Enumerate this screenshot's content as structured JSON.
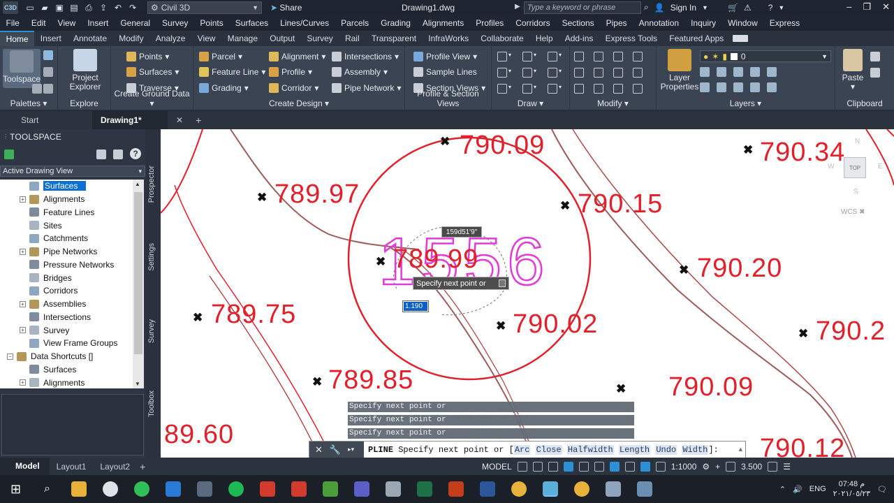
{
  "app": {
    "workspace": "Civil 3D",
    "share_label": "Share",
    "document_title": "Drawing1.dwg",
    "search_placeholder": "Type a keyword or phrase",
    "sign_in": "Sign In",
    "logo_text": "C3D"
  },
  "menu": [
    "File",
    "Edit",
    "View",
    "Insert",
    "General",
    "Survey",
    "Points",
    "Surfaces",
    "Lines/Curves",
    "Parcels",
    "Grading",
    "Alignments",
    "Profiles",
    "Corridors",
    "Sections",
    "Pipes",
    "Annotation",
    "Inquiry",
    "Window",
    "Express"
  ],
  "ribbon_tabs": [
    "Home",
    "Insert",
    "Annotate",
    "Modify",
    "Analyze",
    "View",
    "Manage",
    "Output",
    "Survey",
    "Rail",
    "Transparent",
    "InfraWorks",
    "Collaborate",
    "Help",
    "Add-ins",
    "Express Tools",
    "Featured Apps"
  ],
  "ribbon": {
    "palettes": {
      "toolspace": "Toolspace",
      "label": "Palettes"
    },
    "explore": {
      "project_explorer_1": "Project",
      "project_explorer_2": "Explorer",
      "label": "Explore"
    },
    "ground": {
      "points": "Points",
      "surfaces": "Surfaces",
      "traverse": "Traverse",
      "label": "Create Ground Data"
    },
    "design": {
      "parcel": "Parcel",
      "feature_line": "Feature Line",
      "grading": "Grading",
      "alignment": "Alignment",
      "profile": "Profile",
      "corridor": "Corridor",
      "intersections": "Intersections",
      "assembly": "Assembly",
      "pipe_network": "Pipe Network",
      "label": "Create Design"
    },
    "profile_section": {
      "profile_view": "Profile View",
      "sample_lines": "Sample Lines",
      "section_views": "Section Views",
      "label": "Profile & Section Views"
    },
    "draw": {
      "label": "Draw"
    },
    "modify": {
      "label": "Modify"
    },
    "layers": {
      "layer_properties_1": "Layer",
      "layer_properties_2": "Properties",
      "current_layer": "0",
      "label": "Layers"
    },
    "clipboard": {
      "paste": "Paste",
      "label": "Clipboard"
    }
  },
  "doc_tabs": {
    "start": "Start",
    "drawing": "Drawing1*"
  },
  "toolspace": {
    "title": "TOOLSPACE",
    "view_select": "Active Drawing View",
    "tree": [
      {
        "label": "Surfaces",
        "expander": "",
        "selected": true
      },
      {
        "label": "Alignments",
        "expander": "+"
      },
      {
        "label": "Feature Lines",
        "expander": ""
      },
      {
        "label": "Sites",
        "expander": ""
      },
      {
        "label": "Catchments",
        "expander": ""
      },
      {
        "label": "Pipe Networks",
        "expander": "+"
      },
      {
        "label": "Pressure Networks",
        "expander": ""
      },
      {
        "label": "Bridges",
        "expander": ""
      },
      {
        "label": "Corridors",
        "expander": ""
      },
      {
        "label": "Assemblies",
        "expander": "+"
      },
      {
        "label": "Intersections",
        "expander": ""
      },
      {
        "label": "Survey",
        "expander": "+"
      },
      {
        "label": "View Frame Groups",
        "expander": ""
      },
      {
        "label": "Data Shortcuts []",
        "expander": "−"
      },
      {
        "label": "Surfaces",
        "expander": ""
      },
      {
        "label": "Alignments",
        "expander": "+"
      }
    ],
    "side_tabs": [
      "Prospector",
      "Settings",
      "Survey",
      "Toolbox"
    ]
  },
  "canvas": {
    "elevations": [
      {
        "value": "790.09"
      },
      {
        "value": "790.34"
      },
      {
        "value": "789.97"
      },
      {
        "value": "790.15"
      },
      {
        "value": "789.99"
      },
      {
        "value": "790.20"
      },
      {
        "value": "789.75"
      },
      {
        "value": "790.02"
      },
      {
        "value": "790.2"
      },
      {
        "value": "789.85"
      },
      {
        "value": "790.09"
      },
      {
        "value": "89.60"
      },
      {
        "value": "790.12"
      }
    ],
    "point_number": "1556",
    "angle_tooltip": "159d51'9\"",
    "prompt_tooltip": "Specify next point or",
    "length_input": "1.190",
    "viewcube": {
      "top": "TOP",
      "north": "N",
      "west": "W",
      "south": "S",
      "east": "E"
    },
    "wcs": "WCS"
  },
  "command": {
    "history": [
      "Specify next point or [Arc/Close/Halfwidth/Length/Undo/Width]:",
      "Specify next point or [Arc/Close/Halfwidth/Length/Undo/Width]:",
      "Specify next point or [Arc/Close/Halfwidth/Length/Undo/Width]:"
    ],
    "name": "PLINE",
    "prompt": "Specify next point or [",
    "options": [
      "Arc",
      "Close",
      "Halfwidth",
      "Length",
      "Undo",
      "Width"
    ],
    "suffix": "]:"
  },
  "layouts": [
    "Model",
    "Layout1",
    "Layout2"
  ],
  "status": {
    "space": "MODEL",
    "scale": "1:1000",
    "value": "3.500"
  },
  "taskbar": {
    "language": "ENG",
    "time": "07:48 م",
    "date": "٢٠٢١/٠٥/٢٣"
  }
}
